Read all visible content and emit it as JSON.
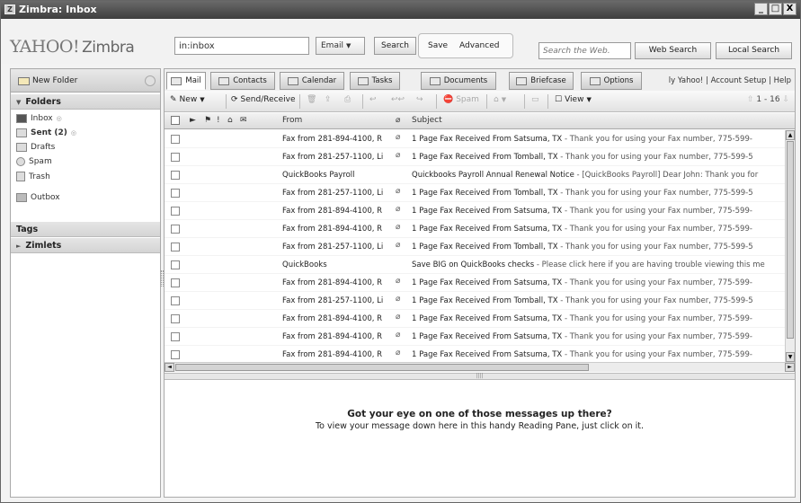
{
  "window": {
    "title": "Zimbra: Inbox",
    "controls": [
      "_",
      "□",
      "X"
    ]
  },
  "header": {
    "logo_yahoo": "YAHOO!",
    "logo_zimbra": "Zimbra",
    "search_value": "in:inbox",
    "search_type": "Email",
    "search_button": "Search",
    "save_link": "Save",
    "advanced_link": "Advanced",
    "web_search_placeholder": "Search the Web.",
    "web_search_button": "Web Search",
    "local_search_button": "Local Search"
  },
  "sidebar": {
    "new_folder": "New Folder",
    "folders_header": "Folders",
    "folders": [
      {
        "label": "Inbox",
        "suffix": "",
        "bold": false,
        "icon": "inbox-icon"
      },
      {
        "label": "Sent (2)",
        "suffix": "",
        "bold": true,
        "icon": "sent-icon"
      },
      {
        "label": "Drafts",
        "suffix": "",
        "bold": false,
        "icon": "drafts-icon"
      },
      {
        "label": "Spam",
        "suffix": "",
        "bold": false,
        "icon": "spam-icon"
      },
      {
        "label": "Trash",
        "suffix": "",
        "bold": false,
        "icon": "trash-icon"
      },
      {
        "label": "Outbox",
        "suffix": "",
        "bold": false,
        "icon": "outbox-icon"
      }
    ],
    "tags_header": "Tags",
    "zimlets_header": "Zimlets"
  },
  "tabs": [
    {
      "label": "Mail",
      "active": true
    },
    {
      "label": "Contacts",
      "active": false
    },
    {
      "label": "Calendar",
      "active": false
    },
    {
      "label": "Tasks",
      "active": false
    },
    {
      "label": "Documents",
      "active": false
    },
    {
      "label": "Briefcase",
      "active": false
    },
    {
      "label": "Options",
      "active": false
    }
  ],
  "top_links": "ly Yahoo! | Account Setup | Help",
  "toolbar": {
    "new": "New",
    "send_receive": "Send/Receive",
    "spam": "Spam",
    "view": "View",
    "pager": "1 - 16"
  },
  "list_header": {
    "from": "From",
    "subject": "Subject"
  },
  "messages": [
    {
      "from": "Fax from 281-894-4100, R",
      "attach": true,
      "subject_bold": "1 Page Fax Received From Satsuma, TX",
      "subject_frag": " - Thank you for using your Fax number, 775-599-"
    },
    {
      "from": "Fax from 281-257-1100, Li",
      "attach": true,
      "subject_bold": "1 Page Fax Received From Tomball, TX",
      "subject_frag": " - Thank you for using your Fax number, 775-599-5"
    },
    {
      "from": "QuickBooks Payroll",
      "attach": false,
      "subject_bold": "Quickbooks Payroll Annual Renewal Notice",
      "subject_frag": " - [QuickBooks Payroll] Dear John: Thank you for"
    },
    {
      "from": "Fax from 281-257-1100, Li",
      "attach": true,
      "subject_bold": "1 Page Fax Received From Tomball, TX",
      "subject_frag": " - Thank you for using your Fax number, 775-599-5"
    },
    {
      "from": "Fax from 281-894-4100, R",
      "attach": true,
      "subject_bold": "1 Page Fax Received From Satsuma, TX",
      "subject_frag": " - Thank you for using your Fax number, 775-599-"
    },
    {
      "from": "Fax from 281-894-4100, R",
      "attach": true,
      "subject_bold": "1 Page Fax Received From Satsuma, TX",
      "subject_frag": " - Thank you for using your Fax number, 775-599-"
    },
    {
      "from": "Fax from 281-257-1100, Li",
      "attach": true,
      "subject_bold": "1 Page Fax Received From Tomball, TX",
      "subject_frag": " - Thank you for using your Fax number, 775-599-5"
    },
    {
      "from": "QuickBooks",
      "attach": false,
      "subject_bold": "Save BIG on QuickBooks checks",
      "subject_frag": " - Please click here if you are having trouble viewing this me"
    },
    {
      "from": "Fax from 281-894-4100, R",
      "attach": true,
      "subject_bold": "1 Page Fax Received From Satsuma, TX",
      "subject_frag": " - Thank you for using your Fax number, 775-599-"
    },
    {
      "from": "Fax from 281-257-1100, Li",
      "attach": true,
      "subject_bold": "1 Page Fax Received From Tomball, TX",
      "subject_frag": " - Thank you for using your Fax number, 775-599-5"
    },
    {
      "from": "Fax from 281-894-4100, R",
      "attach": true,
      "subject_bold": "1 Page Fax Received From Satsuma, TX",
      "subject_frag": " - Thank you for using your Fax number, 775-599-"
    },
    {
      "from": "Fax from 281-894-4100, R",
      "attach": true,
      "subject_bold": "1 Page Fax Received From Satsuma, TX",
      "subject_frag": " - Thank you for using your Fax number, 775-599-"
    },
    {
      "from": "Fax from 281-894-4100, R",
      "attach": true,
      "subject_bold": "1 Page Fax Received From Satsuma, TX",
      "subject_frag": " - Thank you for using your Fax number, 775-599-"
    }
  ],
  "reading_pane": {
    "headline": "Got your eye on one of those messages up there?",
    "subline": "To view your message down here in this handy Reading Pane, just click on it."
  }
}
